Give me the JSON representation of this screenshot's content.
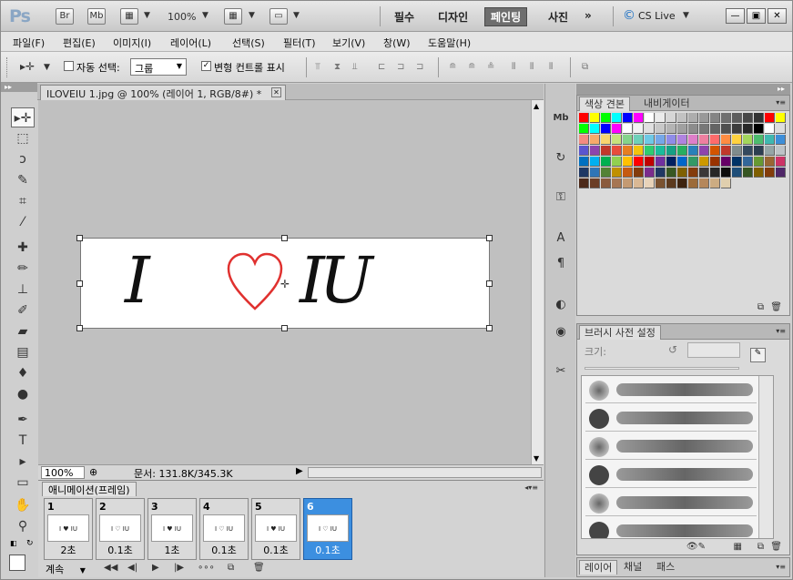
{
  "app": {
    "logo": "Ps",
    "bridge_label": "Br",
    "minibridge_label": "Mb",
    "zoom": "100%",
    "workspaces": [
      "필수",
      "디자인",
      "페인팅",
      "사진"
    ],
    "active_workspace": "페인팅",
    "more_label": "»",
    "cslive_label": "CS Live"
  },
  "menu": [
    "파일(F)",
    "편집(E)",
    "이미지(I)",
    "레이어(L)",
    "선택(S)",
    "필터(T)",
    "보기(V)",
    "창(W)",
    "도움말(H)"
  ],
  "options": {
    "auto_select_label": "자동 선택:",
    "auto_select_checked": false,
    "auto_select_value": "그룹",
    "transform_controls_label": "변형 컨트롤 표시",
    "transform_controls_checked": true
  },
  "document": {
    "tab_title": "ILOVEIU 1.jpg @ 100% (레이어 1, RGB/8#) *",
    "canvas_text_left": "I",
    "canvas_text_right": "IU",
    "heart_color": "#e0312f"
  },
  "status": {
    "zoom": "100%",
    "doc_size": "문서: 131.8K/345.3K"
  },
  "animation": {
    "tab_label": "애니메이션(프레임)",
    "frames": [
      {
        "num": "1",
        "duration": "2초"
      },
      {
        "num": "2",
        "duration": "0.1초"
      },
      {
        "num": "3",
        "duration": "1초"
      },
      {
        "num": "4",
        "duration": "0.1초"
      },
      {
        "num": "5",
        "duration": "0.1초"
      },
      {
        "num": "6",
        "duration": "0.1초"
      }
    ],
    "active_frame": 6,
    "loop_label": "계속"
  },
  "panels": {
    "swatches_tab": "색상 견본",
    "navigator_tab": "내비게이터",
    "brush_tab": "브러시 사전 설정",
    "brush_size_label": "크기:",
    "layers_tab": "레이어",
    "channels_tab": "채널",
    "paths_tab": "패스"
  },
  "colors": {
    "accent": "#3c8fe0",
    "foreground": "#ffffff",
    "background": "#ffffff"
  }
}
